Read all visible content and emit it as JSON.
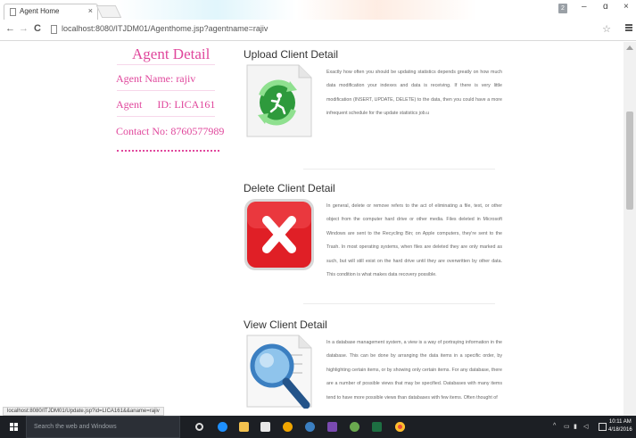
{
  "browser": {
    "tab_title": "Agent Home",
    "tab_close": "×",
    "url": "localhost:8080/ITJDM01/Agenthome.jsp?agentname=rajiv",
    "back": "←",
    "forward": "→",
    "reload": "C",
    "star": "☆",
    "minimize": "–",
    "maximize": "ɑ",
    "close": "×",
    "user_badge": "2"
  },
  "agent": {
    "heading": "Agent Detail",
    "name_line": "Agent Name: rajiv",
    "id_label": "Agent",
    "id_value": "ID: LICA161",
    "contact_line": "Contact No: 8760577989"
  },
  "sections": {
    "upload": {
      "title": "Upload Client Detail",
      "text": "Exactly how often you should be updating statistics depends greatly on how much data modification your indexes and data is receiving. If there is very little modification (INSERT, UPDATE, DELETE) to the data, then you could have a more infrequent schedule for the update statistics job.u"
    },
    "delete": {
      "title": "Delete Client Detail",
      "text": "In general, delete or remove refers to the act of eliminating a file, text, or other object from the computer hard drive or other media. Files deleted in Microsoft Windows are sent to the Recycling Bin; on Apple computers, they're sent to the Trash. In most operating systems, when files are deleted they are only marked as such, but will still exist on the hard drive until they are overwritten by other data. This condition is what makes data recovery possible."
    },
    "view": {
      "title": "View Client Detail",
      "text": "In a database management system, a view is a way of portraying information in the database. This can be done by arranging the data items in a specific order, by highlighting certain items, or by showing only certain items. For any database, there are a number of possible views that may be specified. Databases with many items tend to have more possible views than databases with few items. Often thought of"
    }
  },
  "status_url": "localhost:8080/ITJDM01/Update.jsp?id=LICA161&&aname=rajiv",
  "taskbar": {
    "search_placeholder": "Search the web and Windows",
    "time": "10:11 AM",
    "date": "4/18/2016"
  },
  "colors": {
    "agent_pink": "#e0479c",
    "taskbar": "#1c1f24"
  }
}
